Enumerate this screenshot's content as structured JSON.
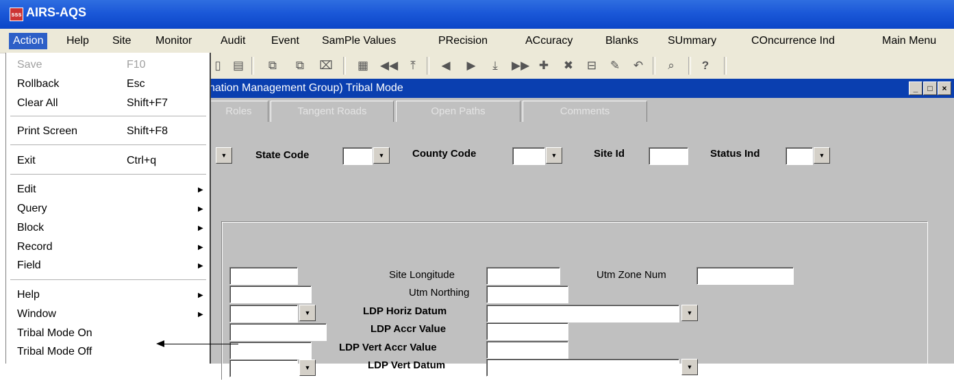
{
  "app": {
    "title": "AIRS-AQS",
    "icon": "app-icon"
  },
  "menubar": {
    "items": [
      {
        "label": "Action",
        "active": true
      },
      {
        "label": "Help"
      },
      {
        "label": "Site"
      },
      {
        "label": "Monitor"
      },
      {
        "label": "Audit"
      },
      {
        "label": "Event"
      },
      {
        "label": "SamPle Values"
      },
      {
        "label": "PRecision"
      },
      {
        "label": "ACcuracy"
      },
      {
        "label": "Blanks"
      },
      {
        "label": "SUmmary"
      },
      {
        "label": "COncurrence Ind"
      },
      {
        "label": "Main Menu"
      }
    ]
  },
  "toolbar": {
    "icons": [
      "print-icon",
      "report-icon",
      "copy-record-icon",
      "paste-record-icon",
      "clear-record-icon",
      "grid-icon",
      "first-record-icon",
      "top-icon",
      "previous-icon",
      "next-icon",
      "down-icon",
      "last-record-icon",
      "insert-icon",
      "delete-icon",
      "duplicate-icon",
      "pin-icon",
      "undo-icon",
      "query-icon",
      "help-icon"
    ]
  },
  "form": {
    "title": "nation Management Group) Tribal Mode",
    "tabs": [
      "Roles",
      "Tangent Roads",
      "Open Paths",
      "Comments"
    ],
    "header_fields": {
      "state_code": "State Code",
      "county_code": "County Code",
      "site_id": "Site Id",
      "status_ind": "Status Ind"
    },
    "fields": {
      "site_longitude": "Site Longitude",
      "utm_zone_num": "Utm Zone Num",
      "utm_northing": "Utm Northing",
      "ldp_horiz_datum": "LDP Horiz Datum",
      "ldp_accr_value": "LDP Accr Value",
      "ldp_vert_accr_value": "LDP Vert Accr Value",
      "ldp_vert_datum": "LDP Vert Datum"
    }
  },
  "action_menu": {
    "items": [
      {
        "label": "Save",
        "shortcut": "F10",
        "disabled": true
      },
      {
        "label": "Rollback",
        "shortcut": "Esc"
      },
      {
        "label": "Clear All",
        "shortcut": "Shift+F7"
      },
      {
        "label": "Print Screen",
        "shortcut": "Shift+F8"
      },
      {
        "label": "Exit",
        "shortcut": "Ctrl+q"
      },
      {
        "label": "Edit"
      },
      {
        "label": "Query"
      },
      {
        "label": "Block"
      },
      {
        "label": "Record"
      },
      {
        "label": "Field"
      },
      {
        "label": "Help"
      },
      {
        "label": "Window"
      },
      {
        "label": "Tribal Mode On"
      },
      {
        "label": "Tribal Mode Off"
      }
    ]
  }
}
